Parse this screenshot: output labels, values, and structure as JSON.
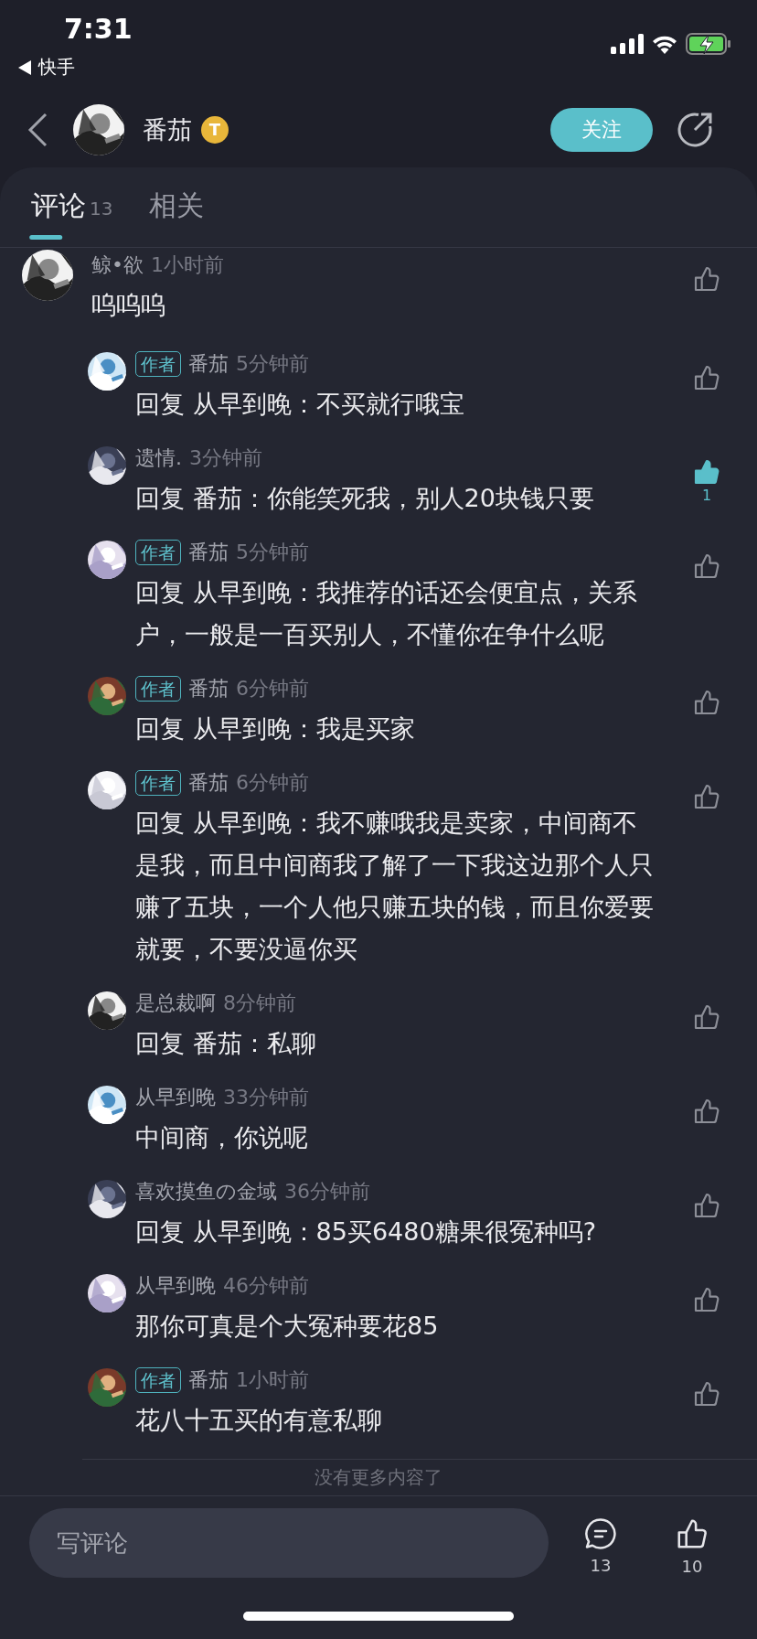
{
  "status_bar": {
    "time": "7:31",
    "back_app": "快手"
  },
  "header": {
    "name": "番茄",
    "badge": "T",
    "follow": "关注"
  },
  "tabs": [
    {
      "label": "评论",
      "count": "13",
      "selected": true
    },
    {
      "label": "相关",
      "selected": false
    }
  ],
  "comments": [
    {
      "kind": "top",
      "name": "鲸•欲",
      "time": "1小时前",
      "text": "呜呜呜",
      "liked": false
    },
    {
      "kind": "reply",
      "tag": "作者",
      "name": "番茄",
      "time": "5分钟前",
      "text": "回复 从早到晚：不买就行哦宝",
      "liked": false
    },
    {
      "kind": "reply",
      "name": "遗情.",
      "time": "3分钟前",
      "text": "回复 番茄：你能笑死我，别人20块钱只要",
      "liked": true,
      "like_count": "1"
    },
    {
      "kind": "reply",
      "tag": "作者",
      "name": "番茄",
      "time": "5分钟前",
      "text": "回复 从早到晚：我推荐的话还会便宜点，关系户，一般是一百买别人，不懂你在争什么呢",
      "liked": false
    },
    {
      "kind": "reply",
      "tag": "作者",
      "name": "番茄",
      "time": "6分钟前",
      "text": "回复 从早到晚：我是买家",
      "liked": false
    },
    {
      "kind": "reply",
      "tag": "作者",
      "name": "番茄",
      "time": "6分钟前",
      "text": "回复 从早到晚：我不赚哦我是卖家，中间商不是我，而且中间商我了解了一下我这边那个人只赚了五块，一个人他只赚五块的钱，而且你爱要就要，不要没逼你买",
      "liked": false
    },
    {
      "kind": "reply",
      "name": "是总裁啊",
      "time": "8分钟前",
      "text": "回复 番茄：私聊",
      "liked": false
    },
    {
      "kind": "reply",
      "name": "从早到晚",
      "time": "33分钟前",
      "text": "中间商，你说呢",
      "liked": false
    },
    {
      "kind": "reply",
      "name": "喜欢摸鱼の金域",
      "time": "36分钟前",
      "text": "回复 从早到晚：85买6480糖果很冤种吗?",
      "liked": false
    },
    {
      "kind": "reply",
      "name": "从早到晚",
      "time": "46分钟前",
      "text": "那你可真是个大冤种要花85",
      "liked": false
    },
    {
      "kind": "reply",
      "tag": "作者",
      "name": "番茄",
      "time": "1小时前",
      "text": "花八十五买的有意私聊",
      "liked": false
    }
  ],
  "end_note": "没有更多内容了",
  "bottom_bar": {
    "placeholder": "写评论",
    "comment_count": "13",
    "like_count": "10"
  }
}
